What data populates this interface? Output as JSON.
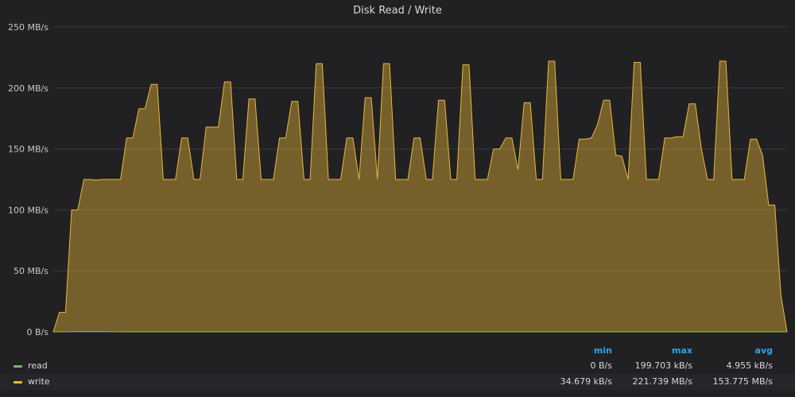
{
  "panel": {
    "title": "Disk Read / Write"
  },
  "chart_data": {
    "type": "area",
    "title": "Disk Read / Write",
    "ylim": [
      0,
      250
    ],
    "yunit": "MB/s",
    "ytick_values": [
      0,
      50,
      100,
      150,
      200,
      250
    ],
    "ytick_labels": [
      "0 B/s",
      "50 MB/s",
      "100 MB/s",
      "150 MB/s",
      "200 MB/s",
      "250 MB/s"
    ],
    "grid": true,
    "legend_placement": "bottom",
    "series": [
      {
        "name": "read",
        "color": "#7eb26d",
        "fill": false,
        "values": [
          0,
          0.2,
          0.1,
          0,
          0,
          0,
          0,
          0,
          0,
          0,
          0,
          0,
          0,
          0,
          0,
          0,
          0,
          0,
          0,
          0,
          0,
          0,
          0,
          0,
          0,
          0,
          0,
          0,
          0,
          0
        ]
      },
      {
        "name": "write",
        "color": "#eab839",
        "fill": true,
        "values": [
          0,
          16,
          16,
          100,
          100,
          125,
          125,
          124.5,
          125,
          125,
          125,
          125,
          159,
          159,
          183,
          183,
          203,
          203,
          125,
          125,
          125,
          159,
          159,
          125,
          125,
          168,
          168,
          168,
          205,
          205,
          125,
          125,
          191,
          191,
          125,
          125,
          125,
          159,
          159,
          189,
          189,
          125,
          125,
          220,
          220,
          125,
          125,
          125,
          159,
          159,
          125,
          192,
          192,
          125,
          220,
          220,
          125,
          125,
          125,
          159,
          159,
          125,
          125,
          190,
          190,
          125,
          125,
          219,
          219,
          125,
          125,
          125,
          150,
          150,
          159,
          159,
          133,
          188,
          188,
          125,
          125,
          222,
          222,
          125,
          125,
          125,
          158,
          158,
          159,
          170,
          190,
          190,
          145,
          144,
          125,
          221,
          221,
          125,
          125,
          125,
          159,
          159,
          160,
          160,
          187,
          187,
          150,
          125,
          125,
          222,
          222,
          125,
          125,
          125,
          158,
          158,
          145,
          104,
          104,
          30,
          0
        ]
      }
    ]
  },
  "legend": {
    "headers": {
      "min": "min",
      "max": "max",
      "avg": "avg"
    },
    "rows": [
      {
        "name": "read",
        "color": "#7eb26d",
        "min": "0 B/s",
        "max": "199.703 kB/s",
        "avg": "4.955 kB/s"
      },
      {
        "name": "write",
        "color": "#eab839",
        "min": "34.679 kB/s",
        "max": "221.739 MB/s",
        "avg": "153.775 MB/s"
      }
    ]
  }
}
